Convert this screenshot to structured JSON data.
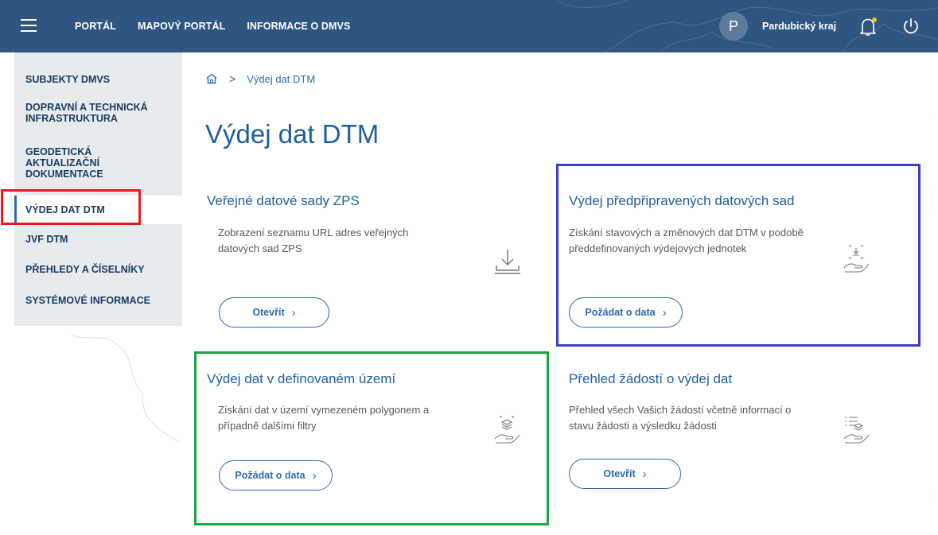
{
  "topbar": {
    "nav": [
      "PORTÁL",
      "MAPOVÝ PORTÁL",
      "INFORMACE O DMVS"
    ],
    "user_initial": "P",
    "region": "Pardubický kraj"
  },
  "sidebar": {
    "items": [
      {
        "label": "SUBJEKTY DMVS"
      },
      {
        "label": "DOPRAVNÍ A TECHNICKÁ INFRASTRUKTURA"
      },
      {
        "label": "GEODETICKÁ AKTUALIZAČNÍ DOKUMENTACE"
      },
      {
        "label": "VÝDEJ DAT DTM",
        "active": true
      },
      {
        "label": "JVF DTM"
      },
      {
        "label": "PŘEHLEDY A ČÍSELNÍKY"
      },
      {
        "label": "SYSTÉMOVÉ INFORMACE"
      }
    ]
  },
  "breadcrumb": {
    "sep": ">",
    "current": "Výdej dat DTM"
  },
  "page_title": "Výdej dat DTM",
  "cards": [
    {
      "title": "Veřejné datové sady ZPS",
      "desc": "Zobrazení seznamu URL adres veřejných datových sad ZPS",
      "button": "Otevřít",
      "icon": "download-tray-icon"
    },
    {
      "title": "Výdej předpřipravených datových sad",
      "desc": "Získání stavových a změnových dat DTM v podobě předdefinovaných výdejových jednotek",
      "button": "Požádat o data",
      "icon": "hand-data-icon"
    },
    {
      "title": "Výdej dat v definovaném území",
      "desc": "Získání dat v území vymezeném polygonem a případně dalšími filtry",
      "button": "Požádat o data",
      "icon": "hand-layers-icon"
    },
    {
      "title": "Přehled žádostí o výdej dat",
      "desc": "Přehled všech Vašich žádostí včetně informací o stavu žádosti a výsledku žádosti",
      "button": "Otevřít",
      "icon": "hand-list-icon"
    }
  ],
  "colors": {
    "topbar": "#2f5680",
    "accent": "#1f5f9d",
    "highlight_red": "#e8191f",
    "highlight_blue": "#3b3fc4",
    "highlight_green": "#20a243"
  }
}
